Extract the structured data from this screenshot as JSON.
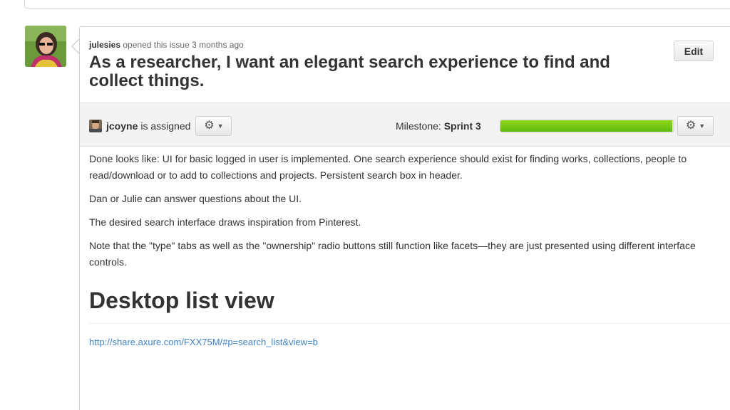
{
  "issue": {
    "author": "julesies",
    "meta_text": "opened this issue 3 months ago",
    "title": "As a researcher, I want an elegant search experience to find and collect things.",
    "edit_label": "Edit"
  },
  "discussion_bar": {
    "assignee": "jcoyne",
    "assignee_suffix": "is assigned",
    "milestone_label": "Milestone:",
    "milestone_name": "Sprint 3",
    "milestone_progress_fraction": 0.99,
    "icons": {
      "settings": "gear-icon",
      "dropdown": "chevron-down-icon"
    },
    "progress_color": "#6cc417"
  },
  "body": {
    "paragraphs": [
      "Done looks like: UI for basic logged in user is implemented. One search experience should exist for finding works, collections, people to read/download or to add to collections and projects. Persistent search box in header.",
      "Dan or Julie can answer questions about the UI.",
      "The desired search interface draws inspiration from Pinterest.",
      "Note that the \"type\" tabs as well as the \"ownership\" radio buttons still function like facets—they are just presented using different interface controls."
    ],
    "heading": "Desktop list view",
    "link": "http://share.axure.com/FXX75M/#p=search_list&view=b"
  },
  "colors": {
    "link": "#4183c4",
    "text": "#333333"
  }
}
